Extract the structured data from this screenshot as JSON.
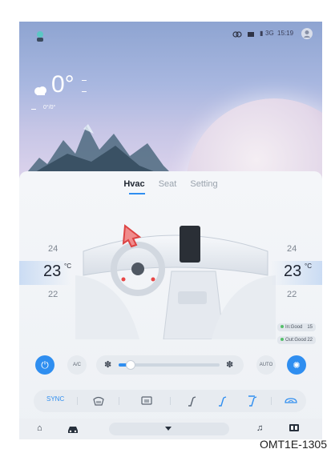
{
  "status": {
    "signal": "3G",
    "time": "15:19"
  },
  "weather": {
    "temp": "0°",
    "range": "0°/0°"
  },
  "tabs": [
    {
      "label": "Hvac",
      "active": true
    },
    {
      "label": "Seat"
    },
    {
      "label": "Setting"
    }
  ],
  "left_zone": {
    "upper": "24",
    "current": "23",
    "unit": "°C",
    "lower": "22"
  },
  "right_zone": {
    "upper": "24",
    "current": "23",
    "unit": "°C",
    "lower": "22"
  },
  "air_quality": {
    "in_label": "In:Good",
    "in_value": "15",
    "out_label": "Out:Good",
    "out_value": "22"
  },
  "controls": {
    "ac_label": "A/C",
    "auto_label": "AUTO",
    "fan_level": 0.12
  },
  "functions": {
    "sync_label": "SYNC"
  },
  "caption": "OMT1E-1305",
  "colors": {
    "accent": "#2f8ef0"
  }
}
